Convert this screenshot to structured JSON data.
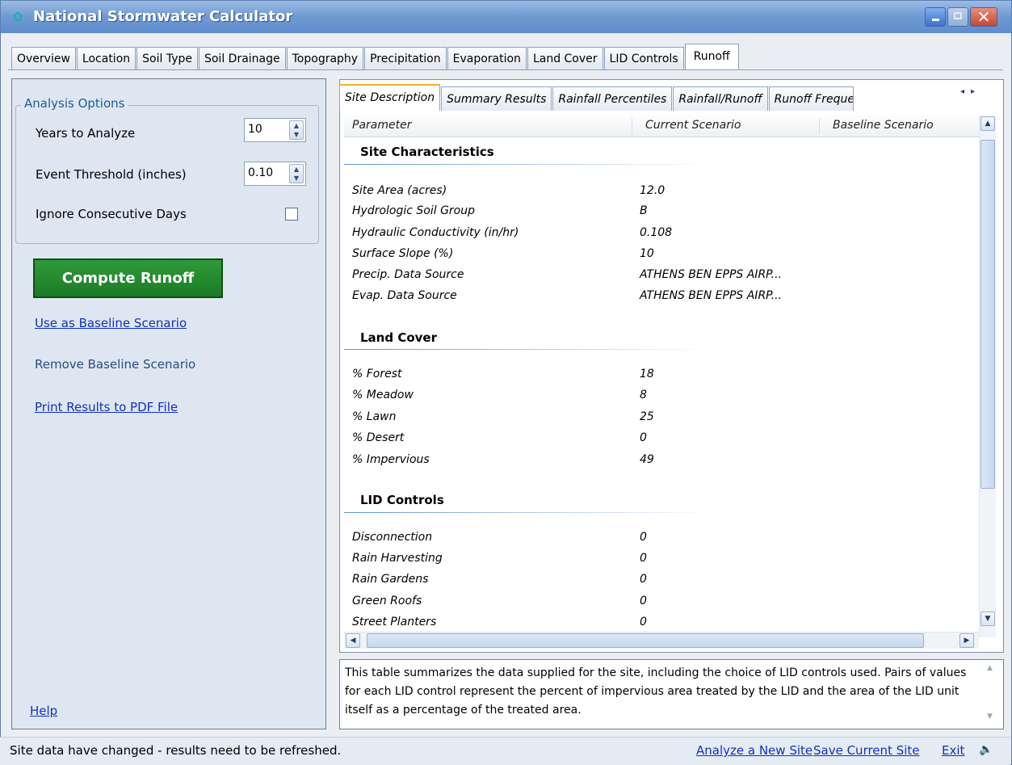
{
  "window": {
    "title": "National Stormwater Calculator"
  },
  "main_tabs": [
    "Overview",
    "Location",
    "Soil Type",
    "Soil Drainage",
    "Topography",
    "Precipitation",
    "Evaporation",
    "Land Cover",
    "LID Controls",
    "Runoff"
  ],
  "analysis_options": {
    "legend": "Analysis Options",
    "years_label": "Years to Analyze",
    "years_value": "10",
    "threshold_label": "Event Threshold (inches)",
    "threshold_value": "0.10",
    "ignore_label": "Ignore Consecutive Days",
    "ignore_checked": false
  },
  "actions": {
    "compute": "Compute Runoff",
    "use_baseline": "Use as Baseline Scenario",
    "remove_baseline": "Remove Baseline Scenario",
    "print_pdf": "Print Results to PDF File",
    "help": "Help"
  },
  "sub_tabs": [
    "Site Description",
    "Summary Results",
    "Rainfall Percentiles",
    "Rainfall/Runoff",
    "Runoff Frequen"
  ],
  "grid": {
    "headers": {
      "parameter": "Parameter",
      "current": "Current Scenario",
      "baseline": "Baseline Scenario"
    },
    "sections": {
      "site": {
        "title": "Site Characteristics",
        "rows": [
          {
            "param": "Site Area (acres)",
            "value": "12.0"
          },
          {
            "param": "Hydrologic Soil Group",
            "value": "B"
          },
          {
            "param": "Hydraulic Conductivity (in/hr)",
            "value": "0.108"
          },
          {
            "param": "Surface Slope (%)",
            "value": "10"
          },
          {
            "param": "Precip. Data Source",
            "value": "ATHENS BEN EPPS AIRP..."
          },
          {
            "param": "Evap. Data Source",
            "value": "ATHENS BEN EPPS AIRP..."
          }
        ]
      },
      "land": {
        "title": "Land Cover",
        "rows": [
          {
            "param": "% Forest",
            "value": "18"
          },
          {
            "param": "% Meadow",
            "value": "8"
          },
          {
            "param": "% Lawn",
            "value": "25"
          },
          {
            "param": "% Desert",
            "value": "0"
          },
          {
            "param": "% Impervious",
            "value": "49"
          }
        ]
      },
      "lid": {
        "title": "LID Controls",
        "rows": [
          {
            "param": "Disconnection",
            "value": "0"
          },
          {
            "param": "Rain Harvesting",
            "value": "0"
          },
          {
            "param": "Rain Gardens",
            "value": "0"
          },
          {
            "param": "Green Roofs",
            "value": "0"
          },
          {
            "param": "Street Planters",
            "value": "0"
          }
        ]
      }
    }
  },
  "description": "This table summarizes the data supplied for the site, including the choice of LID controls used. Pairs of values for each LID control represent the percent of impervious area treated by the LID and the area of the LID unit itself as a percentage of the treated area.",
  "status": {
    "message": "Site data have changed - results need to be refreshed.",
    "analyze_new": "Analyze a New Site",
    "save_current": "Save Current Site",
    "exit": "Exit"
  },
  "colors": {
    "compute_green": "#1c7b26",
    "link_blue": "#1131c0",
    "panel_bg": "#dee6f2",
    "active_tab_accent": "#f3b22c"
  }
}
